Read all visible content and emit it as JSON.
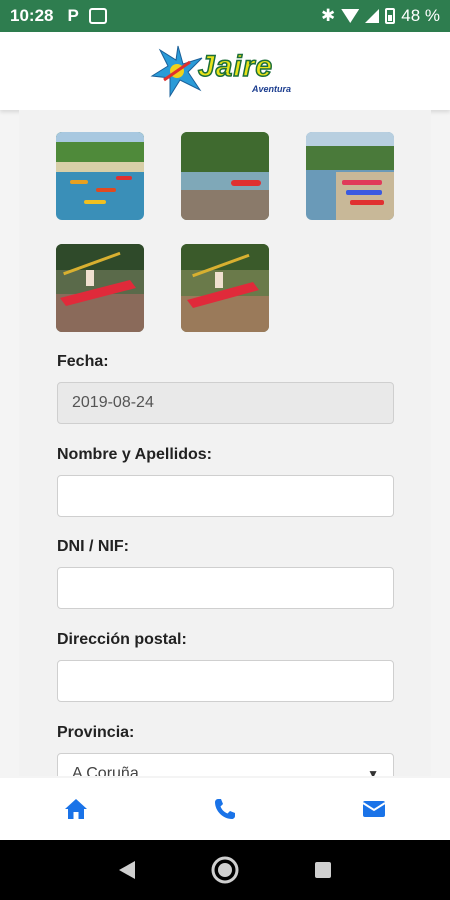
{
  "status_bar": {
    "time": "10:28",
    "notification_letter": "P",
    "battery_percent": "48 %"
  },
  "header": {
    "logo_text": "Jaire",
    "logo_subtext": "Aventura"
  },
  "gallery": {
    "images": [
      "kayaks-on-beach",
      "kayak-on-river",
      "rafts-on-shore",
      "kayaker-splash-1",
      "kayaker-splash-2"
    ]
  },
  "form": {
    "fecha": {
      "label": "Fecha:",
      "value": "2019-08-24"
    },
    "nombre": {
      "label": "Nombre y Apellidos:",
      "value": ""
    },
    "dni": {
      "label": "DNI / NIF:",
      "value": ""
    },
    "direccion": {
      "label": "Dirección postal:",
      "value": ""
    },
    "provincia": {
      "label": "Provincia:",
      "value": "A Coruña"
    }
  },
  "bottom_nav": {
    "icons": [
      "home-icon",
      "phone-icon",
      "mail-icon"
    ],
    "accent_color": "#1a73e8"
  },
  "colors": {
    "status_bar": "#2e7d4f"
  }
}
